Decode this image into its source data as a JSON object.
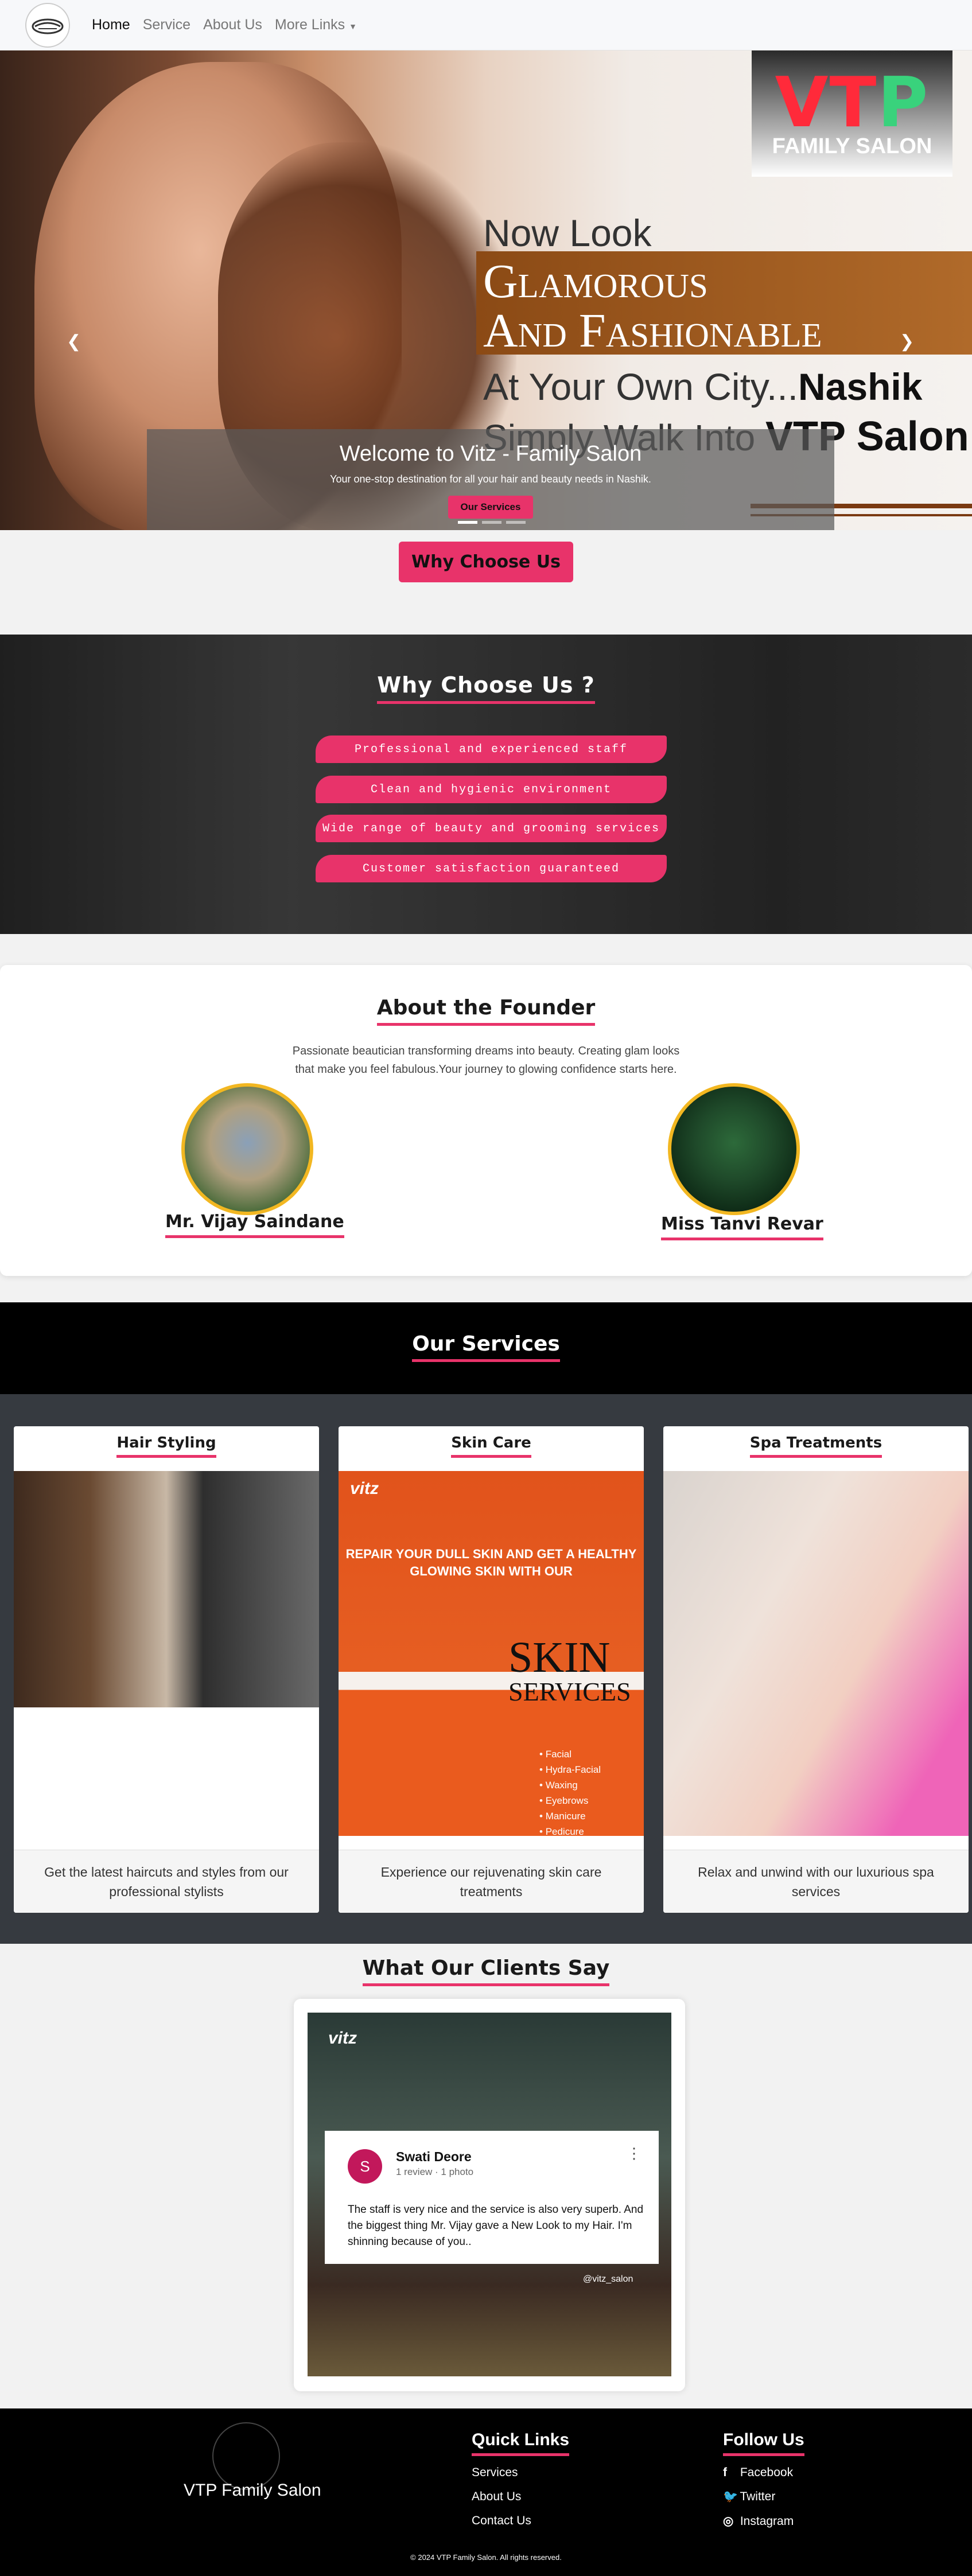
{
  "nav": {
    "items": [
      {
        "label": "Home"
      },
      {
        "label": "Service"
      },
      {
        "label": "About Us"
      },
      {
        "label": "More Links"
      }
    ]
  },
  "hero": {
    "brand": "VTP",
    "brand_sub": "FAMILY SALON",
    "line1": "Now Look",
    "line2a": "Glamorous",
    "line2b": "And Fashionable",
    "line3a": "At Your Own City...",
    "line3b": "Nashik",
    "line4a": "Simply Walk Into",
    "line4b": "VTP Salon",
    "caption_title": "Welcome to Vitz - Family Salon",
    "caption_text": "Your one-stop destination for all your hair and beauty needs in Nashik.",
    "caption_button": "Our Services",
    "slide_count": 3,
    "active_slide": 1
  },
  "why_button": "Why Choose Us",
  "why": {
    "title": "Why Choose Us ?",
    "items": [
      "Professional and experienced staff",
      "Clean and hygienic environment",
      "Wide range of beauty and grooming services",
      "Customer satisfaction guaranteed"
    ]
  },
  "founder": {
    "title": "About the Founder",
    "text": "Passionate beautician transforming dreams into beauty. Creating glam looks that make you feel fabulous.Your journey to glowing confidence starts here.",
    "people": [
      {
        "name": "Mr. Vijay Saindane"
      },
      {
        "name": "Miss Tanvi Revar"
      }
    ]
  },
  "services": {
    "title": "Our Services",
    "cards": [
      {
        "title": "Hair Styling",
        "desc": "Get the latest haircuts and styles from our professional stylists"
      },
      {
        "title": "Skin Care",
        "desc": "Experience our rejuvenating skin care treatments"
      },
      {
        "title": "Spa Treatments",
        "desc": "Relax and unwind with our luxurious spa services"
      }
    ],
    "skin_poster": {
      "brand": "vitz",
      "headline": "REPAIR YOUR DULL SKIN AND GET A HEALTHY GLOWING SKIN WITH OUR",
      "big": "SKIN",
      "big_sub": "SERVICES",
      "list": [
        "Facial",
        "Hydra-Facial",
        "Waxing",
        "Eyebrows",
        "Manicure",
        "Pedicure"
      ]
    }
  },
  "testimonials": {
    "title": "What Our Clients Say",
    "brand": "vitz",
    "reviewer_initial": "S",
    "reviewer_name": "Swati Deore",
    "reviewer_meta": "1 review · 1 photo",
    "review_text": "The staff is very nice and the service is also very superb. And the biggest thing Mr. Vijay gave a New Look to my Hair. I'm shinning because of you..",
    "handle": "@vitz_salon"
  },
  "footer": {
    "brand": "VTP Family Salon",
    "quick_title": "Quick Links",
    "quick_links": [
      "Services",
      "About Us",
      "Contact Us"
    ],
    "follow_title": "Follow Us",
    "social": [
      "Facebook",
      "Twitter",
      "Instagram"
    ],
    "copyright": "© 2024 VTP Family Salon. All rights reserved."
  },
  "colors": {
    "accent": "#e8336a",
    "navbar_bg": "#f7f8fa",
    "footer_bg": "#000000",
    "services_bg": "#363a40"
  }
}
